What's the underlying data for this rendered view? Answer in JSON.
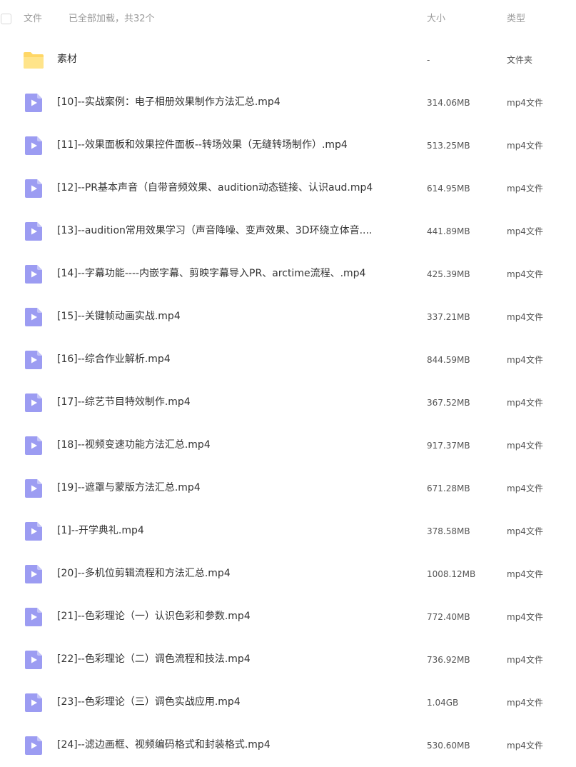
{
  "header": {
    "file_label": "文件",
    "status_text": "已全部加载，共32个",
    "size_label": "大小",
    "type_label": "类型"
  },
  "colors": {
    "video_icon": "#9c9cf2",
    "folder_icon": "#ffd766",
    "header_text": "#9a9a9a"
  },
  "files": [
    {
      "name": "素材",
      "size": "-",
      "type": "文件夹",
      "icon": "folder-icon"
    },
    {
      "name": "[10]--实战案例：电子相册效果制作方法汇总.mp4",
      "size": "314.06MB",
      "type": "mp4文件",
      "icon": "video-file-icon"
    },
    {
      "name": "[11]--效果面板和效果控件面板--转场效果（无缝转场制作）.mp4",
      "size": "513.25MB",
      "type": "mp4文件",
      "icon": "video-file-icon"
    },
    {
      "name": "[12]--PR基本声音（自带音频效果、audition动态链接、认识aud.mp4",
      "size": "614.95MB",
      "type": "mp4文件",
      "icon": "video-file-icon"
    },
    {
      "name": "[13]--audition常用效果学习（声音降噪、变声效果、3D环绕立体音....",
      "size": "441.89MB",
      "type": "mp4文件",
      "icon": "video-file-icon"
    },
    {
      "name": "[14]--字幕功能----内嵌字幕、剪映字幕导入PR、arctime流程、.mp4",
      "size": "425.39MB",
      "type": "mp4文件",
      "icon": "video-file-icon"
    },
    {
      "name": "[15]--关键帧动画实战.mp4",
      "size": "337.21MB",
      "type": "mp4文件",
      "icon": "video-file-icon"
    },
    {
      "name": "[16]--综合作业解析.mp4",
      "size": "844.59MB",
      "type": "mp4文件",
      "icon": "video-file-icon"
    },
    {
      "name": "[17]--综艺节目特效制作.mp4",
      "size": "367.52MB",
      "type": "mp4文件",
      "icon": "video-file-icon"
    },
    {
      "name": "[18]--视频变速功能方法汇总.mp4",
      "size": "917.37MB",
      "type": "mp4文件",
      "icon": "video-file-icon"
    },
    {
      "name": "[19]--遮罩与蒙版方法汇总.mp4",
      "size": "671.28MB",
      "type": "mp4文件",
      "icon": "video-file-icon"
    },
    {
      "name": "[1]--开学典礼.mp4",
      "size": "378.58MB",
      "type": "mp4文件",
      "icon": "video-file-icon"
    },
    {
      "name": "[20]--多机位剪辑流程和方法汇总.mp4",
      "size": "1008.12MB",
      "type": "mp4文件",
      "icon": "video-file-icon"
    },
    {
      "name": "[21]--色彩理论（一）认识色彩和参数.mp4",
      "size": "772.40MB",
      "type": "mp4文件",
      "icon": "video-file-icon"
    },
    {
      "name": "[22]--色彩理论（二）调色流程和技法.mp4",
      "size": "736.92MB",
      "type": "mp4文件",
      "icon": "video-file-icon"
    },
    {
      "name": "[23]--色彩理论（三）调色实战应用.mp4",
      "size": "1.04GB",
      "type": "mp4文件",
      "icon": "video-file-icon"
    },
    {
      "name": "[24]--滤边画框、视频编码格式和封装格式.mp4",
      "size": "530.60MB",
      "type": "mp4文件",
      "icon": "video-file-icon"
    }
  ]
}
